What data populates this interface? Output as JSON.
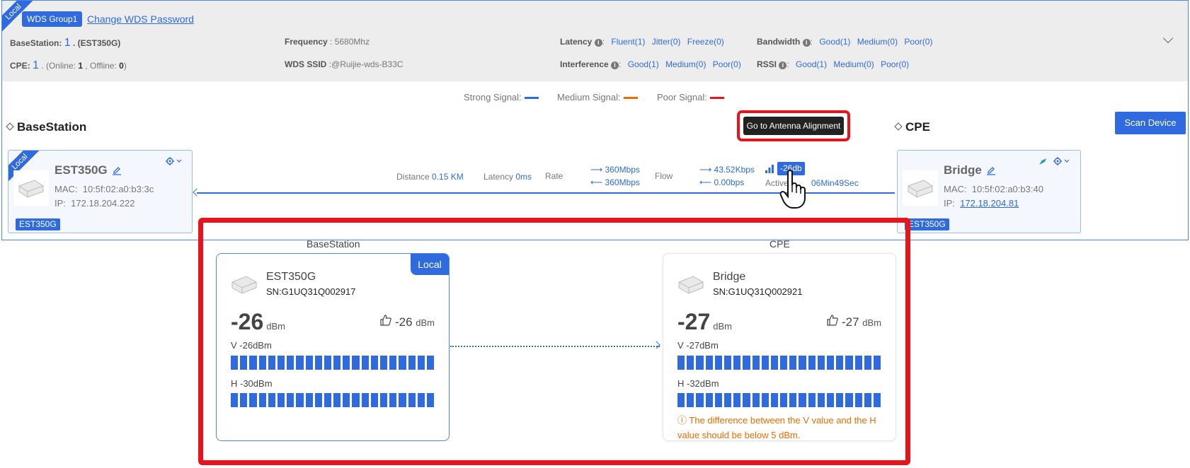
{
  "header": {
    "ribbon": "Local",
    "group_badge": "WDS Group1",
    "change_password": "Change WDS Password",
    "basestation": {
      "label": "BaseStation",
      "count": "1",
      "model": ". (EST350G)"
    },
    "cpe": {
      "label": "CPE",
      "count": "1",
      "online_label": ". (Online:",
      "online": "1",
      "offline_label": ", Offline:",
      "offline": "0",
      "close": ")"
    },
    "frequency": {
      "label": "Frequency",
      "value": ": 5680Mhz"
    },
    "wds_ssid": {
      "label": "WDS SSID",
      "value": ":@Ruijie-wds-B33C"
    },
    "latency": {
      "label": "Latency",
      "items": [
        "Fluent(1)",
        "Jitter(0)",
        "Freeze(0)"
      ]
    },
    "interference": {
      "label": "Interference",
      "items": [
        "Good(1)",
        "Medium(0)",
        "Poor(0)"
      ]
    },
    "bandwidth": {
      "label": "Bandwidth",
      "items": [
        "Good(1)",
        "Medium(0)",
        "Poor(0)"
      ]
    },
    "rssi": {
      "label": "RSSI",
      "items": [
        "Good(1)",
        "Medium(0)",
        "Poor(0)"
      ]
    }
  },
  "legend": {
    "strong": "Strong Signal:",
    "medium": "Medium Signal:",
    "poor": "Poor Signal:",
    "colors": {
      "strong": "#2f6bde",
      "medium": "#ef6c00",
      "poor": "#e8141b"
    }
  },
  "sections": {
    "basestation": "BaseStation",
    "cpe": "CPE"
  },
  "buttons": {
    "antenna": "Go to Antenna Alignment",
    "scan": "Scan Device"
  },
  "base_device": {
    "ribbon": "Local",
    "name": "EST350G",
    "mac_label": "MAC:",
    "mac": "10:5f:02:a0:b3:3c",
    "ip_label": "IP:",
    "ip": "172.18.204.222",
    "tag": "EST350G"
  },
  "cpe_device": {
    "name": "Bridge",
    "mac_label": "MAC:",
    "mac": "10:5f:02:a0:b3:40",
    "ip_label": "IP:",
    "ip": "172.18.204.81",
    "tag": "EST350G"
  },
  "link": {
    "distance_label": "Distance",
    "distance": "0.15 KM",
    "latency_label": "Latency",
    "latency": "0ms",
    "rate_label": "Rate",
    "rate_tx": "360Mbps",
    "rate_rx": "360Mbps",
    "flow_label": "Flow",
    "flow_tx": "43.52Kbps",
    "flow_rx": "0.00bps",
    "signal": "-26db",
    "active_label": "Active",
    "active": "06Min49Sec"
  },
  "alignment": {
    "base": {
      "heading": "BaseStation",
      "local_tag": "Local",
      "name": "EST350G",
      "sn": "SN:G1UQ31Q002917",
      "value": "-26",
      "unit": "dBm",
      "best": "-26",
      "best_unit": "dBm",
      "v_label": "V -26dBm",
      "h_label": "H -30dBm",
      "v_bars": 22,
      "h_bars": 22
    },
    "cpe": {
      "heading": "CPE",
      "name": "Bridge",
      "sn": "SN:G1UQ31Q002921",
      "value": "-27",
      "unit": "dBm",
      "best": "-27",
      "best_unit": "dBm",
      "v_label": "V -27dBm",
      "h_label": "H -32dBm",
      "v_bars": 22,
      "h_bars": 22,
      "warning": "The difference between the V value and the H value should be below 5 dBm."
    }
  }
}
